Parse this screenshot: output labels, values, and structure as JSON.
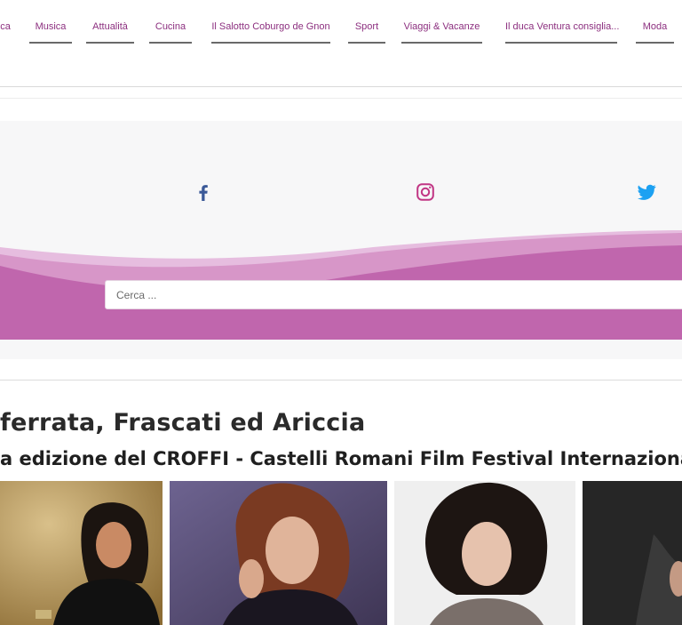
{
  "nav": {
    "items": [
      {
        "label": "ca"
      },
      {
        "label": "Musica"
      },
      {
        "label": "Attualità"
      },
      {
        "label": "Cucina"
      },
      {
        "label": "Il Salotto Coburgo de Gnon"
      },
      {
        "label": "Sport"
      },
      {
        "label": "Viaggi & Vacanze"
      },
      {
        "label": "Il duca Ventura consiglia..."
      },
      {
        "label": "Moda"
      }
    ]
  },
  "social": {
    "icons": [
      "facebook-icon",
      "instagram-icon",
      "twitter-icon"
    ],
    "colors": {
      "facebook": "#3b5998",
      "instagram": "#c13584",
      "twitter": "#1da1f2"
    }
  },
  "search": {
    "placeholder": "Cerca ..."
  },
  "article": {
    "title": "ferrata, Frascati ed Ariccia",
    "subtitle": "a edizione del CROFFI - Castelli Romani Film Festival Internazionale"
  },
  "colors": {
    "accent": "#8c2f7f",
    "wave_dark": "#c066ad",
    "wave_light": "#dfa8d3"
  }
}
